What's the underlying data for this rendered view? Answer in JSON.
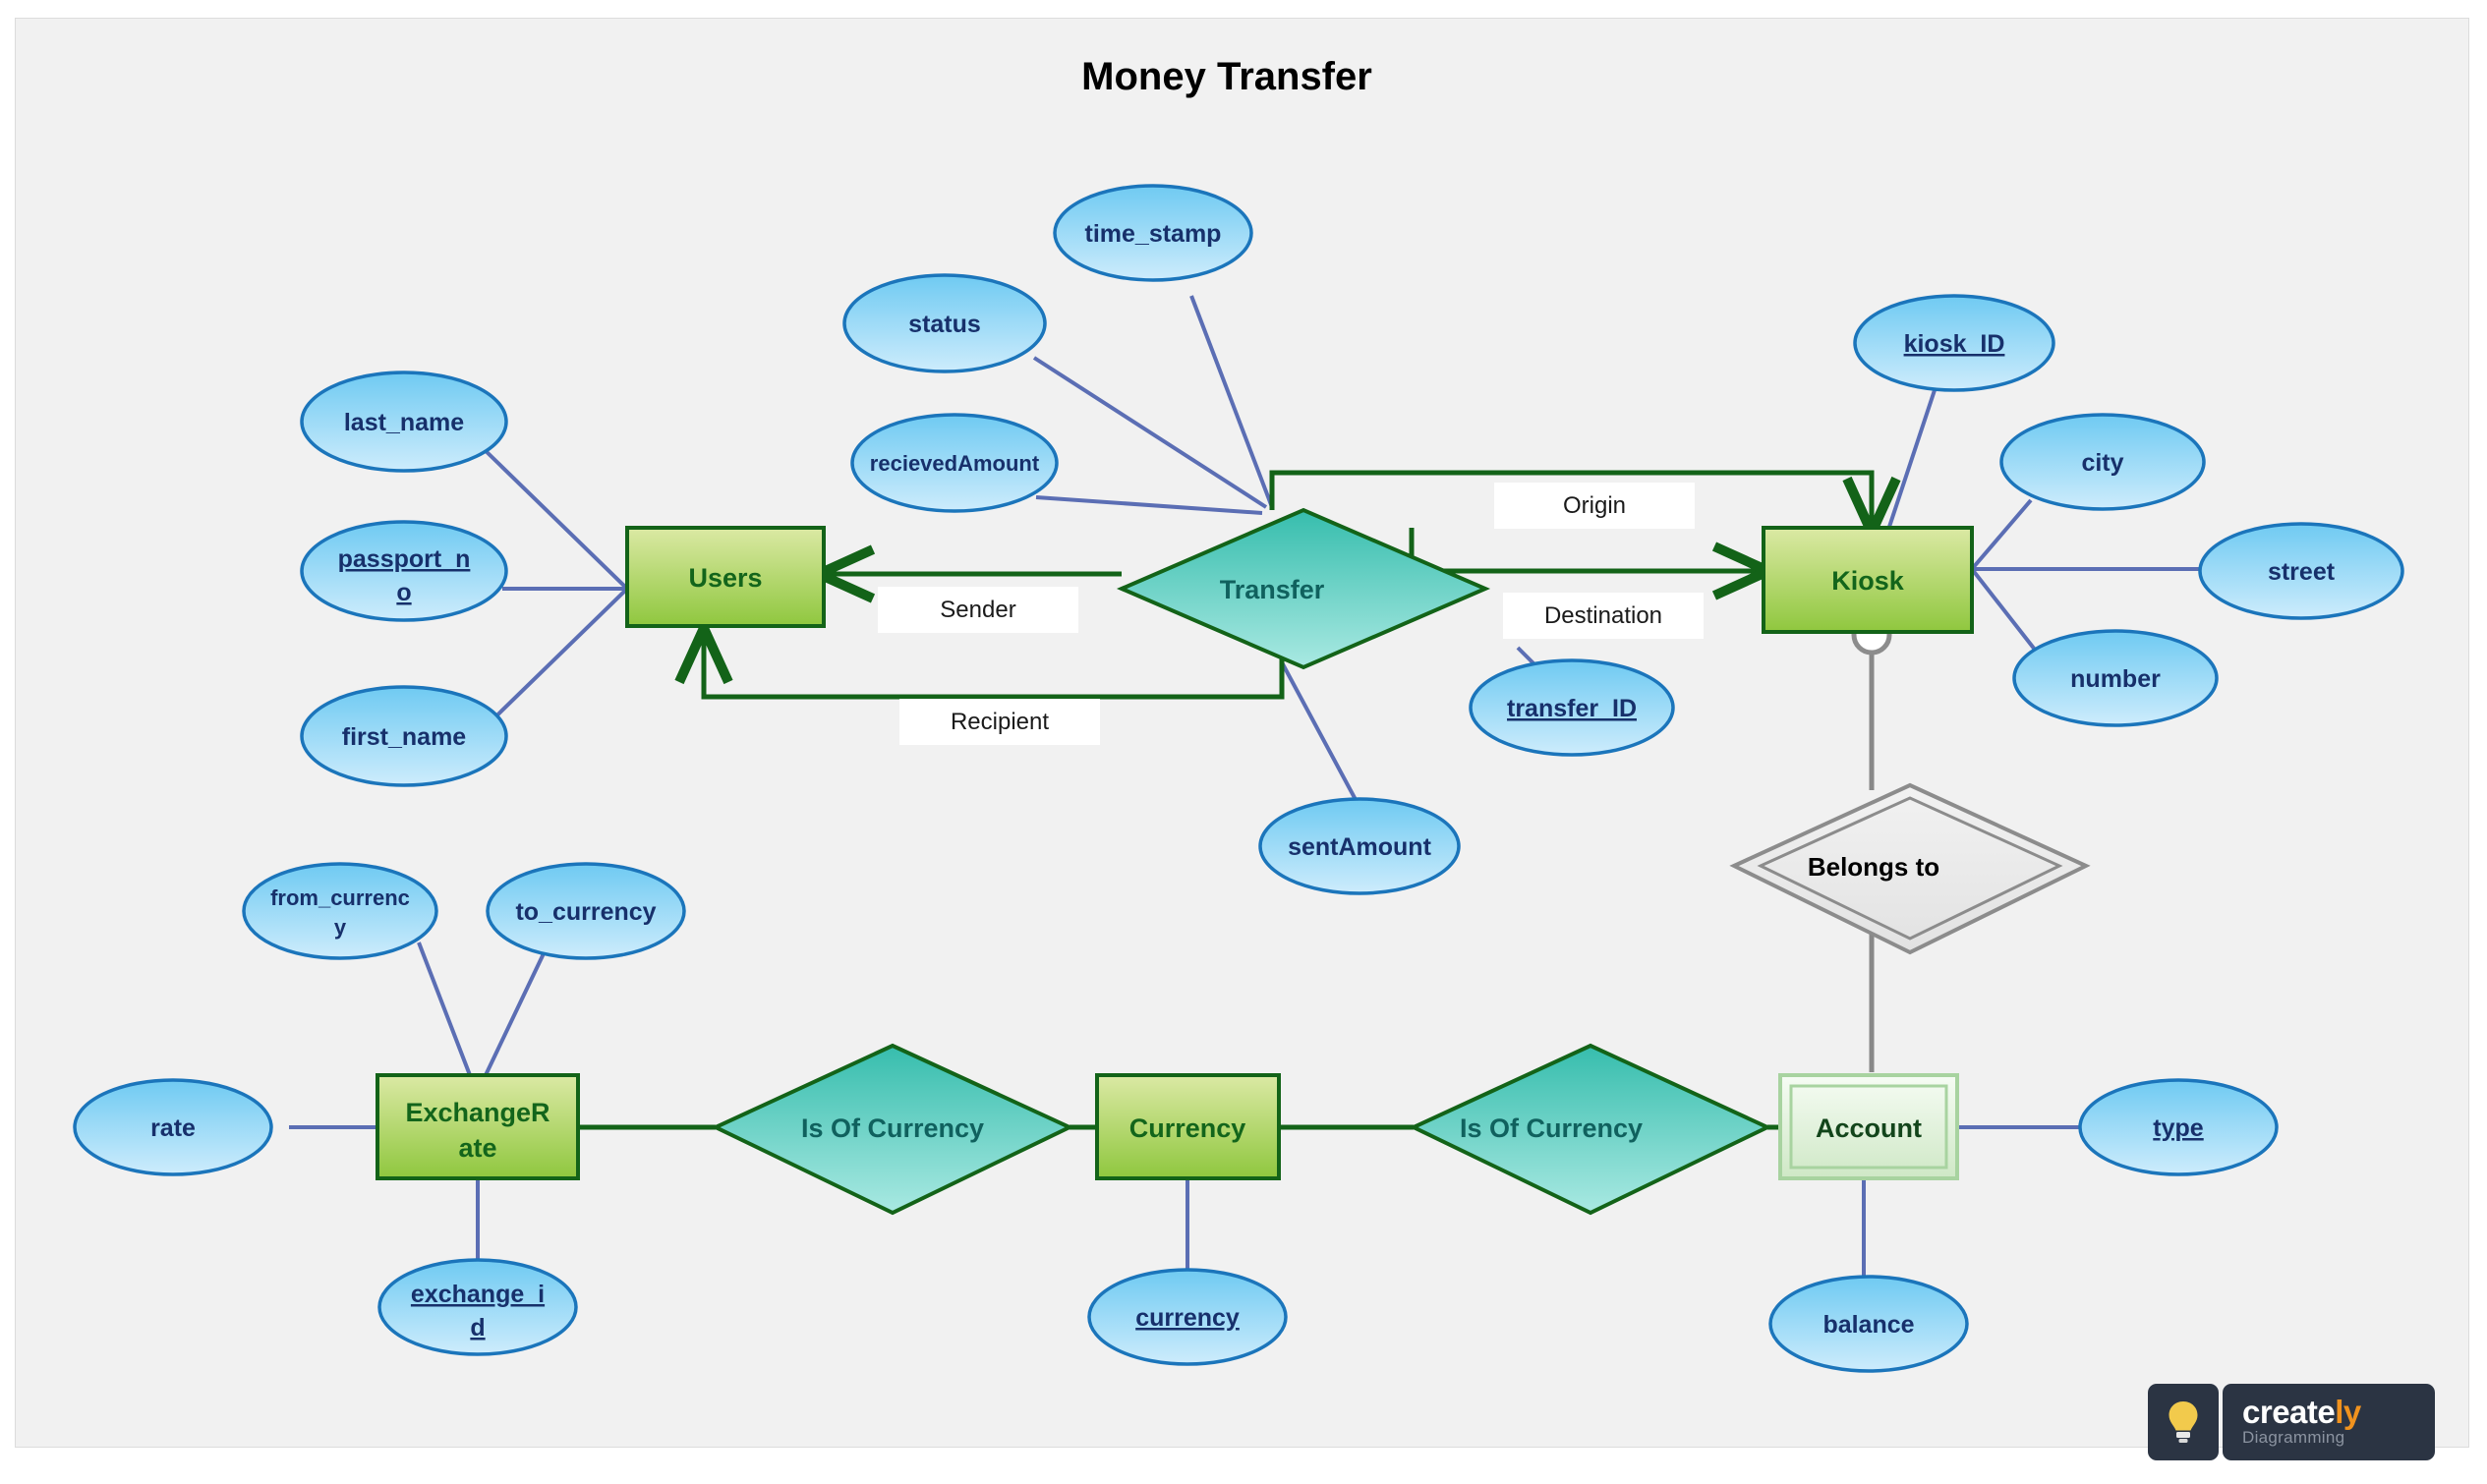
{
  "title": "Money Transfer",
  "canvas": {
    "background_color": "#f1f1f1",
    "border_color": "#dcdcdc"
  },
  "colors": {
    "entity_fill_top": "#d6e49a",
    "entity_fill_bottom": "#93c83e",
    "entity_stroke": "#136318",
    "entity_text": "#13651b",
    "weak_entity_fill_top": "#f4fbf1",
    "weak_entity_fill_bottom": "#cfe6c6",
    "weak_entity_stroke": "#a8d3a0",
    "relationship_fill_top": "#3bbfae",
    "relationship_fill_bottom": "#a7e7e0",
    "relationship_stroke": "#136318",
    "relationship_text": "#10615e",
    "weak_rel_fill": "#e8e8e8",
    "weak_rel_stroke": "#8c8c8c",
    "attribute_fill_top": "#73ccf2",
    "attribute_fill_bottom": "#c5e9fb",
    "attribute_stroke": "#1b75bb",
    "attribute_text": "#17306b",
    "attribute_connector": "#5b6eb4",
    "relationship_connector": "#136318",
    "weak_connector": "#888888"
  },
  "entities": [
    {
      "id": "users",
      "label": "Users",
      "type": "strong"
    },
    {
      "id": "kiosk",
      "label": "Kiosk",
      "type": "strong"
    },
    {
      "id": "exchange_rate",
      "label": "ExchangeRate",
      "label_line1": "ExchangeR",
      "label_line2": "ate",
      "type": "strong"
    },
    {
      "id": "currency_entity",
      "label": "Currency",
      "type": "strong"
    },
    {
      "id": "account",
      "label": "Account",
      "type": "weak"
    }
  ],
  "relationships": [
    {
      "id": "transfer",
      "label": "Transfer",
      "type": "strong"
    },
    {
      "id": "belongs_to",
      "label": "Belongs to",
      "type": "identifying"
    },
    {
      "id": "is_of_currency_1",
      "label": "Is Of Currency",
      "type": "strong"
    },
    {
      "id": "is_of_currency_2",
      "label": "Is Of Currency",
      "type": "strong"
    }
  ],
  "attributes": [
    {
      "id": "last_name",
      "label": "last_name",
      "owner": "users",
      "key": false
    },
    {
      "id": "passport_no",
      "label": "passport_no",
      "label_line1": "passport_n",
      "label_line2": "o",
      "owner": "users",
      "key": true
    },
    {
      "id": "first_name",
      "label": "first_name",
      "owner": "users",
      "key": false
    },
    {
      "id": "status",
      "label": "status",
      "owner": "transfer",
      "key": false
    },
    {
      "id": "time_stamp",
      "label": "time_stamp",
      "owner": "transfer",
      "key": false
    },
    {
      "id": "recieved_amount",
      "label": "recievedAmount",
      "owner": "transfer",
      "key": false
    },
    {
      "id": "sent_amount",
      "label": "sentAmount",
      "owner": "transfer",
      "key": false
    },
    {
      "id": "transfer_id",
      "label": "transfer_ID",
      "owner": "transfer",
      "key": true
    },
    {
      "id": "kiosk_id",
      "label": "kiosk_ID",
      "owner": "kiosk",
      "key": true
    },
    {
      "id": "city",
      "label": "city",
      "owner": "kiosk",
      "key": false
    },
    {
      "id": "street",
      "label": "street",
      "owner": "kiosk",
      "key": false
    },
    {
      "id": "number",
      "label": "number",
      "owner": "kiosk",
      "key": false
    },
    {
      "id": "from_currency",
      "label": "from_currency",
      "label_line1": "from_currenc",
      "label_line2": "y",
      "owner": "exchange_rate",
      "key": false
    },
    {
      "id": "to_currency",
      "label": "to_currency",
      "owner": "exchange_rate",
      "key": false
    },
    {
      "id": "rate",
      "label": "rate",
      "owner": "exchange_rate",
      "key": false
    },
    {
      "id": "exchange_id",
      "label": "exchange_id",
      "label_line1": "exchange_i",
      "label_line2": "d",
      "owner": "exchange_rate",
      "key": true
    },
    {
      "id": "currency_attr",
      "label": "currency",
      "owner": "currency_entity",
      "key": true
    },
    {
      "id": "type_attr",
      "label": "type",
      "owner": "account",
      "key": true
    },
    {
      "id": "balance",
      "label": "balance",
      "owner": "account",
      "key": false
    }
  ],
  "edge_labels": [
    {
      "id": "sender",
      "label": "Sender",
      "from": "transfer",
      "to": "users"
    },
    {
      "id": "recipient",
      "label": "Recipient",
      "from": "transfer",
      "to": "users"
    },
    {
      "id": "origin",
      "label": "Origin",
      "from": "transfer",
      "to": "kiosk"
    },
    {
      "id": "destination",
      "label": "Destination",
      "from": "transfer",
      "to": "kiosk"
    }
  ],
  "watermark": {
    "brand_create": "create",
    "brand_ly": "ly",
    "tagline": "Diagramming",
    "icon": "lightbulb-icon"
  }
}
